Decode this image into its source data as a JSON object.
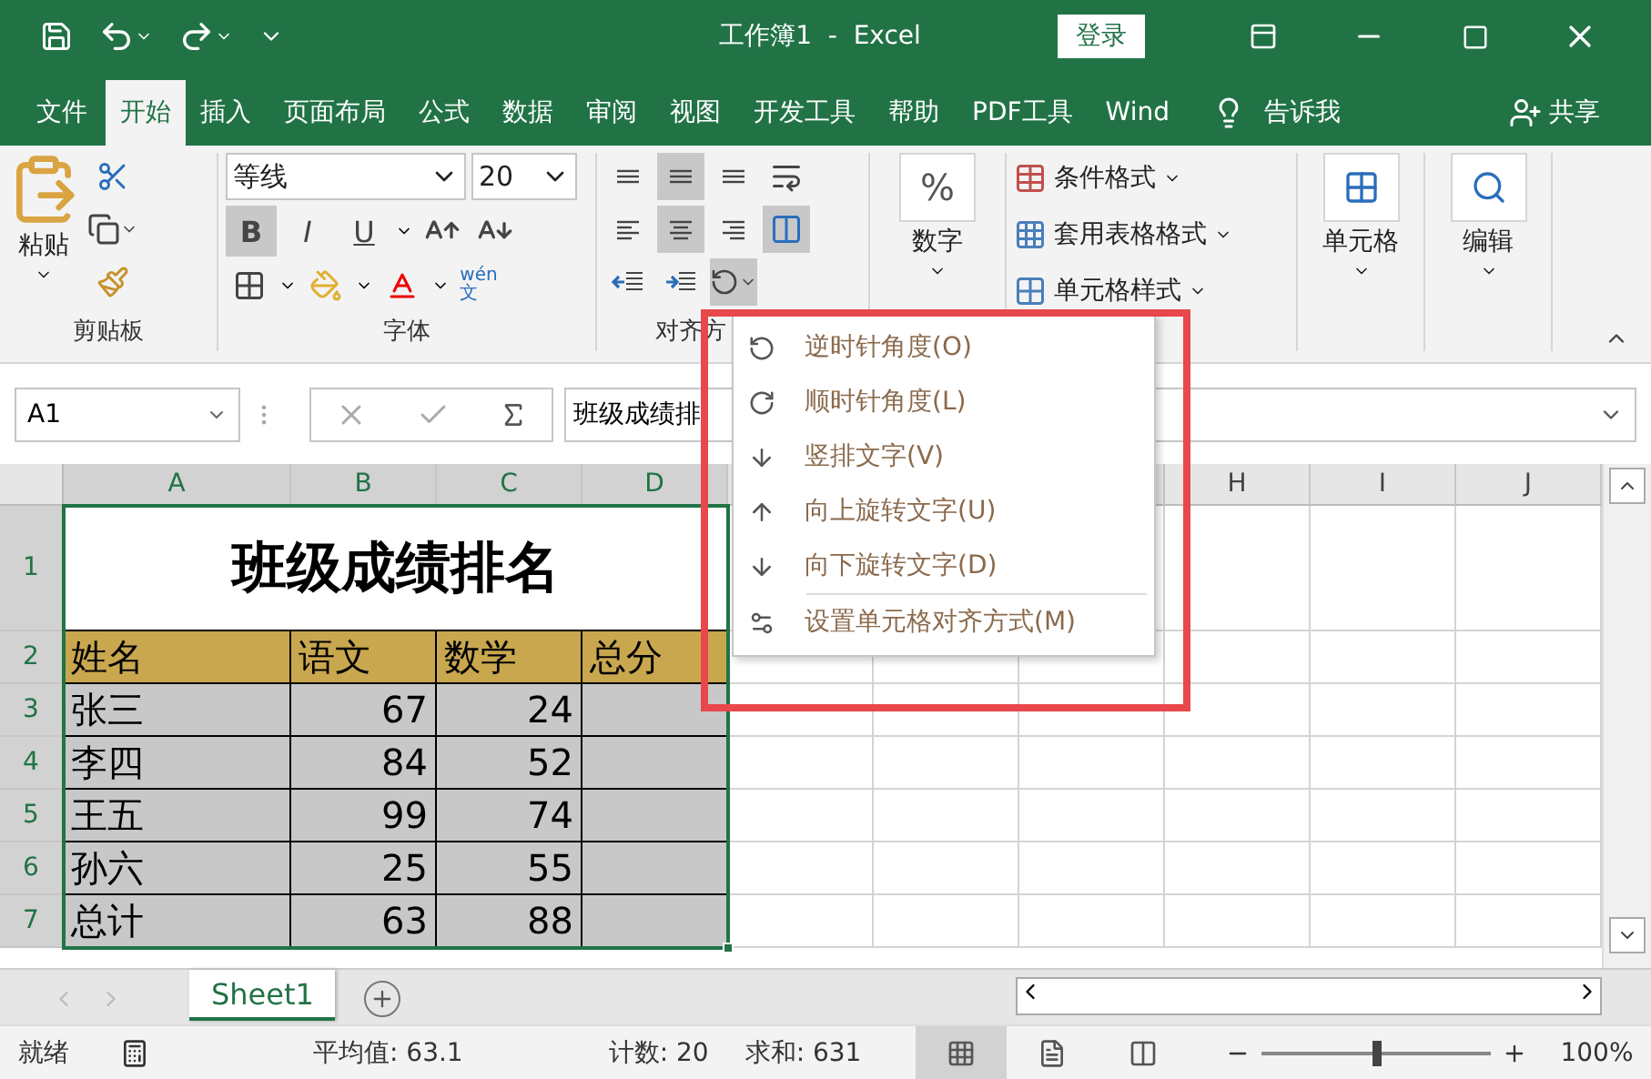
{
  "title_bar": {
    "title": "工作簿1  -  Excel",
    "login": "登录"
  },
  "menu_tabs": [
    {
      "label": "文件",
      "selected": false
    },
    {
      "label": "开始",
      "selected": true
    },
    {
      "label": "插入",
      "selected": false
    },
    {
      "label": "页面布局",
      "selected": false
    },
    {
      "label": "公式",
      "selected": false
    },
    {
      "label": "数据",
      "selected": false
    },
    {
      "label": "审阅",
      "selected": false
    },
    {
      "label": "视图",
      "selected": false
    },
    {
      "label": "开发工具",
      "selected": false
    },
    {
      "label": "帮助",
      "selected": false
    },
    {
      "label": "PDF工具",
      "selected": false
    },
    {
      "label": "Wind",
      "selected": false
    }
  ],
  "tell_me": "告诉我",
  "share": "共享",
  "clipboard": {
    "paste": "粘贴",
    "label": "剪贴板"
  },
  "font": {
    "name": "等线",
    "size": "20",
    "label": "字体",
    "phonetic_top": "wén",
    "phonetic_bottom": "文",
    "toggles": [
      {
        "kind": "bold",
        "text": "B",
        "selected": true
      },
      {
        "kind": "italic",
        "text": "I",
        "selected": false
      },
      {
        "kind": "underline",
        "text": "U",
        "selected": false
      }
    ]
  },
  "alignment": {
    "label": "对齐方",
    "buttons": [
      {
        "kind": "top",
        "selected": false
      },
      {
        "kind": "middle",
        "selected": true
      },
      {
        "kind": "bottom",
        "selected": false
      },
      {
        "kind": "left",
        "selected": false
      },
      {
        "kind": "center",
        "selected": true
      },
      {
        "kind": "right",
        "selected": false
      }
    ],
    "merge": {
      "selected": true
    },
    "orientation": {
      "selected": true
    }
  },
  "number": {
    "label": "数字",
    "symbol": "%"
  },
  "styles": [
    {
      "kind": "conditional",
      "label": "条件格式"
    },
    {
      "kind": "table",
      "label": "套用表格格式"
    },
    {
      "kind": "cell",
      "label": "单元格样式"
    }
  ],
  "cells": {
    "label": "单元格"
  },
  "editing": {
    "label": "编辑"
  },
  "formula_bar": {
    "name_box": "A1",
    "value": "班级成绩排"
  },
  "sheet": {
    "columns_left": [
      "A",
      "B",
      "C",
      "D"
    ],
    "columns_right": [
      "H",
      "I",
      "J"
    ],
    "row_numbers": [
      "1",
      "2",
      "3",
      "4",
      "5",
      "6",
      "7"
    ],
    "title": "班级成绩排名",
    "header": [
      "姓名",
      "语文",
      "数学",
      "总分"
    ],
    "rows": [
      [
        "张三",
        "67",
        "24",
        ""
      ],
      [
        "李四",
        "84",
        "52",
        ""
      ],
      [
        "王五",
        "99",
        "74",
        ""
      ],
      [
        "孙六",
        "25",
        "55",
        ""
      ],
      [
        "总计",
        "63",
        "88",
        ""
      ]
    ]
  },
  "menu": {
    "items": [
      {
        "kind": "ccw",
        "label": "逆时针角度(O)"
      },
      {
        "kind": "cw",
        "label": "顺时针角度(L)"
      },
      {
        "kind": "vertical",
        "label": "竖排文字(V)"
      },
      {
        "kind": "up",
        "label": "向上旋转文字(U)"
      },
      {
        "kind": "down",
        "label": "向下旋转文字(D)"
      },
      {
        "kind": "format",
        "label": "设置单元格对齐方式(M)"
      }
    ]
  },
  "sheet_tabs": [
    {
      "label": "Sheet1",
      "selected": true
    }
  ],
  "status": {
    "ready": "就绪",
    "average": "平均值: 63.1",
    "count": "计数: 20",
    "sum": "求和: 631",
    "views": [
      {
        "kind": "normal",
        "selected": true
      },
      {
        "kind": "layout",
        "selected": false
      },
      {
        "kind": "break",
        "selected": false
      }
    ],
    "zoom": {
      "label": "100%",
      "level": 0.5
    }
  }
}
